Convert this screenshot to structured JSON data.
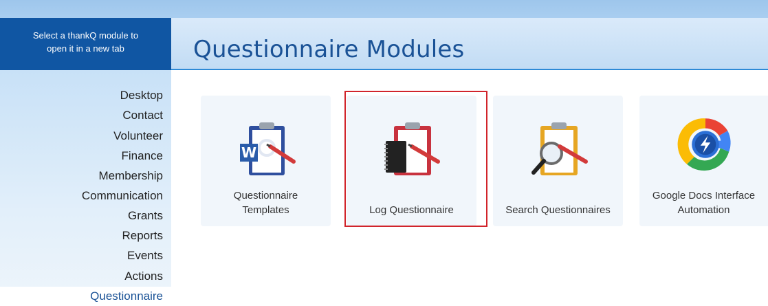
{
  "header": {
    "instruction": "Select a thankQ module to open it in a new tab",
    "title": "Questionnaire Modules"
  },
  "sidebar": {
    "items": [
      {
        "label": "Desktop"
      },
      {
        "label": "Contact"
      },
      {
        "label": "Volunteer"
      },
      {
        "label": "Finance"
      },
      {
        "label": "Membership"
      },
      {
        "label": "Communication"
      },
      {
        "label": "Grants"
      },
      {
        "label": "Reports"
      },
      {
        "label": "Events"
      },
      {
        "label": "Actions"
      },
      {
        "label": "Questionnaire",
        "active": true
      }
    ]
  },
  "modules": [
    {
      "label": "Questionnaire Templates",
      "icon": "clipboard-word-icon"
    },
    {
      "label": "Log Questionnaire",
      "icon": "clipboard-notebook-icon",
      "selected": true
    },
    {
      "label": "Search Questionnaires",
      "icon": "clipboard-magnifier-icon"
    },
    {
      "label": "Google Docs Interface Automation",
      "icon": "google-docs-automation-icon"
    }
  ],
  "colors": {
    "brand_blue": "#1056a3",
    "title_blue": "#1a5296",
    "selection_red": "#d1242b"
  }
}
